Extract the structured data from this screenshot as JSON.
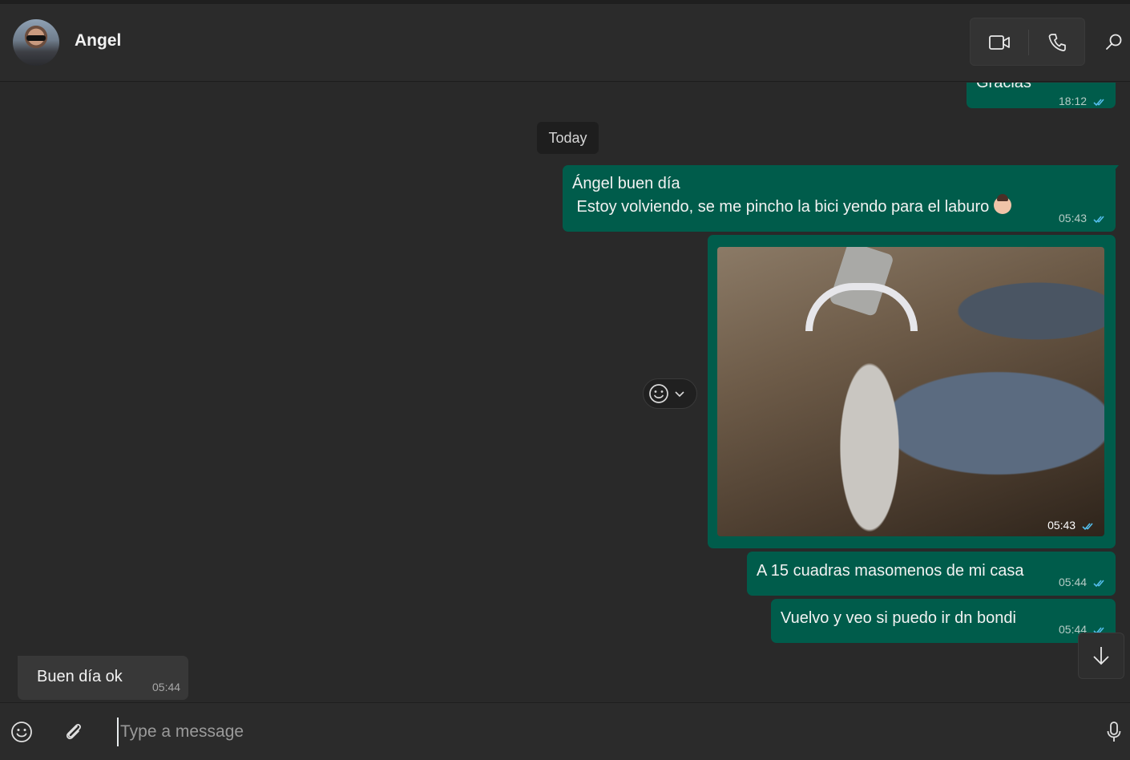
{
  "header": {
    "contact_name": "Angel"
  },
  "chat": {
    "day_separator": "Today",
    "messages": [
      {
        "direction": "out",
        "text": "Gracias",
        "time": "18:12",
        "status": "read"
      },
      {
        "direction": "out",
        "line1": "Ángel buen día",
        "line2": " Estoy volviendo, se me pincho la bici yendo para el laburo",
        "emoji": "woman-facepalming",
        "time": "05:43",
        "status": "read"
      },
      {
        "direction": "out",
        "type": "image",
        "time": "05:43",
        "status": "read"
      },
      {
        "direction": "out",
        "text": "A 15 cuadras masomenos de mi casa",
        "time": "05:44",
        "status": "read"
      },
      {
        "direction": "out",
        "text": "Vuelvo y veo si puedo ir dn bondi",
        "time": "05:44",
        "status": "read"
      },
      {
        "direction": "in",
        "text": "Buen día ok",
        "time": "05:44"
      }
    ]
  },
  "composer": {
    "placeholder": "Type a message"
  },
  "icons": {
    "video": "video-camera-icon",
    "call": "phone-icon",
    "search": "search-icon",
    "emoji": "smiley-icon",
    "attach": "paperclip-icon",
    "mic": "microphone-icon",
    "scroll": "arrow-down-icon",
    "tick": "double-check-icon"
  },
  "colors": {
    "background": "#292929",
    "outgoing_bubble": "#005c4b",
    "incoming_bubble": "#383838",
    "read_ticks": "#53bdeb"
  }
}
